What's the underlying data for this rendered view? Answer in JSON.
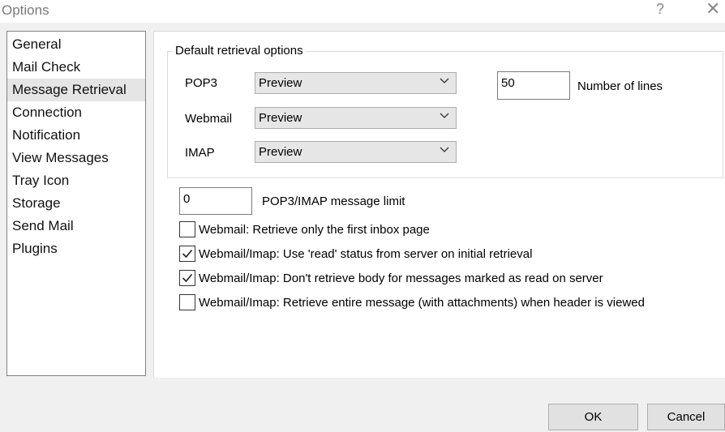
{
  "window": {
    "title": "Options",
    "help_glyph": "?",
    "close_glyph": "✕"
  },
  "sidebar": {
    "items": [
      {
        "label": "General"
      },
      {
        "label": "Mail Check"
      },
      {
        "label": "Message Retrieval",
        "selected": true
      },
      {
        "label": "Connection"
      },
      {
        "label": "Notification"
      },
      {
        "label": "View Messages"
      },
      {
        "label": "Tray Icon"
      },
      {
        "label": "Storage"
      },
      {
        "label": "Send Mail"
      },
      {
        "label": "Plugins"
      }
    ]
  },
  "retrieval": {
    "group_title": "Default retrieval options",
    "pop3": {
      "label": "POP3",
      "value": "Preview"
    },
    "webmail": {
      "label": "Webmail",
      "value": "Preview"
    },
    "imap": {
      "label": "IMAP",
      "value": "Preview"
    },
    "lines": {
      "value": "50",
      "label": "Number of lines"
    }
  },
  "limit": {
    "value": "0",
    "label": "POP3/IMAP message limit"
  },
  "checkboxes": [
    {
      "label": "Webmail: Retrieve only the first inbox page",
      "checked": false
    },
    {
      "label": "Webmail/Imap: Use 'read' status from server on initial retrieval",
      "checked": true
    },
    {
      "label": "Webmail/Imap: Don't retrieve body for messages marked as read on server",
      "checked": true
    },
    {
      "label": "Webmail/Imap: Retrieve entire message (with attachments) when header is viewed",
      "checked": false
    }
  ],
  "buttons": {
    "ok": "OK",
    "cancel": "Cancel"
  }
}
